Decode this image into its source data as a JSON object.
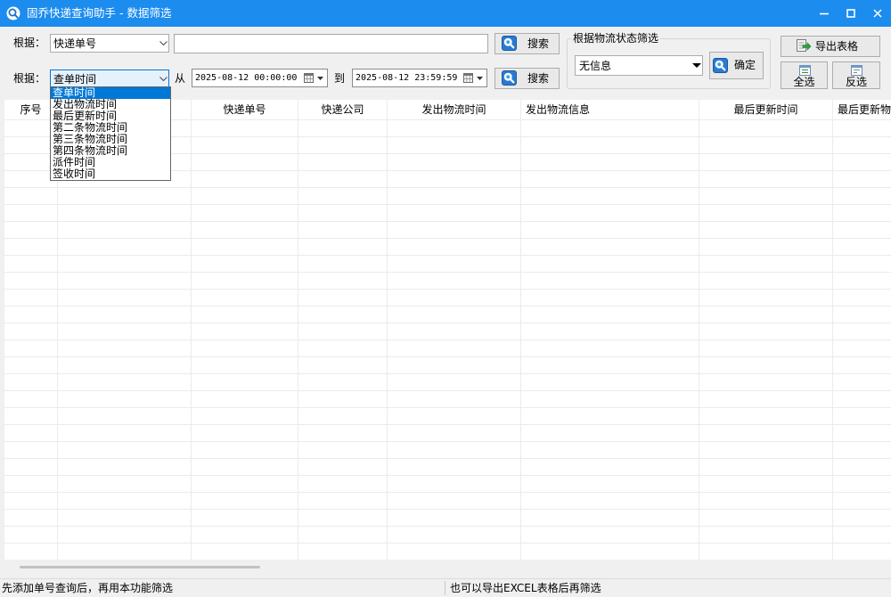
{
  "window": {
    "title": "固乔快递查询助手 - 数据筛选",
    "app_icon": "magnifier-icon",
    "controls": {
      "minimize": "minimize-icon",
      "maximize": "maximize-icon",
      "close": "close-icon"
    }
  },
  "filter_by_field": {
    "label": "根据：",
    "field_select": {
      "value": "快递单号",
      "icon": "chevron-down-icon"
    },
    "keyword_input": {
      "value": ""
    },
    "search_button": {
      "label": "搜索",
      "icon": "search-icon"
    }
  },
  "filter_by_time": {
    "label": "根据：",
    "time_select": {
      "value": "查单时间",
      "expanded": true,
      "highlighted_index": 0,
      "options": [
        "查单时间",
        "发出物流时间",
        "最后更新时间",
        "第二条物流时间",
        "第三条物流时间",
        "第四条物流时间",
        "派件时间",
        "签收时间"
      ]
    },
    "from_label": "从",
    "start_datetime": "2025-08-12 00:00:00",
    "to_label": "到",
    "end_datetime": "2025-08-12 23:59:59",
    "date_picker_icon": "calendar-icon",
    "search_button": {
      "label": "搜索",
      "icon": "search-icon"
    }
  },
  "status_filter": {
    "legend": "根据物流状态筛选",
    "status_select": {
      "value": "无信息",
      "icon": "triangle-down-icon"
    },
    "confirm_button": {
      "label": "确定",
      "icon": "search-icon"
    }
  },
  "actions": {
    "export_button": {
      "label": "导出表格",
      "icon": "export-icon"
    },
    "select_all_button": {
      "label": "全选",
      "icon": "select-all-icon"
    },
    "invert_selection_button": {
      "label": "反选",
      "icon": "invert-selection-icon"
    }
  },
  "table": {
    "columns": [
      "序号",
      "",
      "快递单号",
      "快递公司",
      "发出物流时间",
      "发出物流信息",
      "最后更新时间",
      "最后更新物"
    ],
    "rows": []
  },
  "status_bar": {
    "hint_left": "先添加单号查询后，再用本功能筛选",
    "hint_right": "也可以导出EXCEL表格后再筛选"
  },
  "colors": {
    "title_bar": "#1C8CEF",
    "selection_highlight": "#0078D7",
    "focus_border": "#0078D7",
    "window_background": "#F0F0F0",
    "grid_line": "#EBEBEB"
  }
}
